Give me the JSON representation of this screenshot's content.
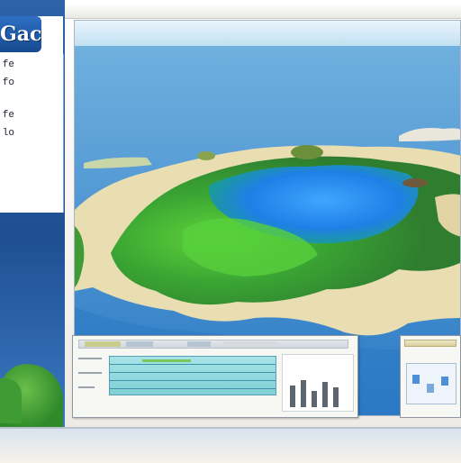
{
  "app": {
    "logo_text": "Gach"
  },
  "left_menu": {
    "items": [
      {
        "label": "fe"
      },
      {
        "label": "fo"
      },
      {
        "label": "fe"
      },
      {
        "label": "lo"
      }
    ]
  },
  "viewport": {
    "scene": "3D terrain island with lagoon",
    "colors": {
      "sky": "#cfe6f5",
      "ocean": "#3d8fd0",
      "lagoon": "#2f7fe0",
      "grass": "#3f9a3c",
      "sand": "#e8dcb3"
    }
  },
  "icons": {
    "logo": "app-logo-icon"
  }
}
